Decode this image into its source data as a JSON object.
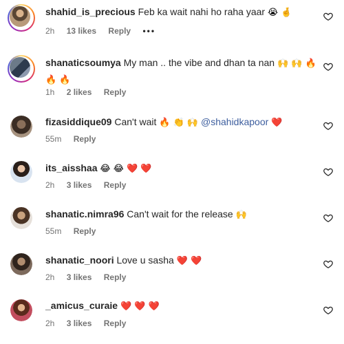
{
  "comments": [
    {
      "username": "shahid_is_precious",
      "text": "Feb ka wait nahi ho raha yaar",
      "emojis": "😭 🤞",
      "time": "2h",
      "likes": "13 likes",
      "reply": "Reply",
      "more": "•••"
    },
    {
      "username": "shanaticsoumya",
      "text": "My man .. the vibe and dhan ta nan",
      "emojis": "🙌 🙌 🔥",
      "emojis_line2": "🔥 🔥",
      "time": "1h",
      "likes": "2 likes",
      "reply": "Reply"
    },
    {
      "username": "fizasiddique09",
      "text": "Can't wait",
      "emojis": "🔥 👏 🙌",
      "mention": "@shahidkapoor",
      "emojis_after": "❤️",
      "time": "55m",
      "reply": "Reply"
    },
    {
      "username": "its_aisshaa",
      "emojis": "😂 😂 ❤️ ❤️",
      "time": "2h",
      "likes": "3 likes",
      "reply": "Reply"
    },
    {
      "username": "shanatic.nimra96",
      "text": "Can't wait for the release",
      "emojis": "🙌",
      "time": "55m",
      "reply": "Reply"
    },
    {
      "username": "shanatic_noori",
      "text": "Love u sasha",
      "emojis": "❤️ ❤️",
      "time": "2h",
      "likes": "3 likes",
      "reply": "Reply"
    },
    {
      "username": "_amicus_curaie",
      "emojis": "❤️ ❤️ ❤️",
      "time": "2h",
      "likes": "3 likes",
      "reply": "Reply"
    }
  ],
  "icons": {
    "like": "heart-outline-icon"
  },
  "colors": {
    "username": "#262626",
    "meta": "#737373",
    "mention": "#3d5e9e",
    "story_ring": "#d62976"
  }
}
